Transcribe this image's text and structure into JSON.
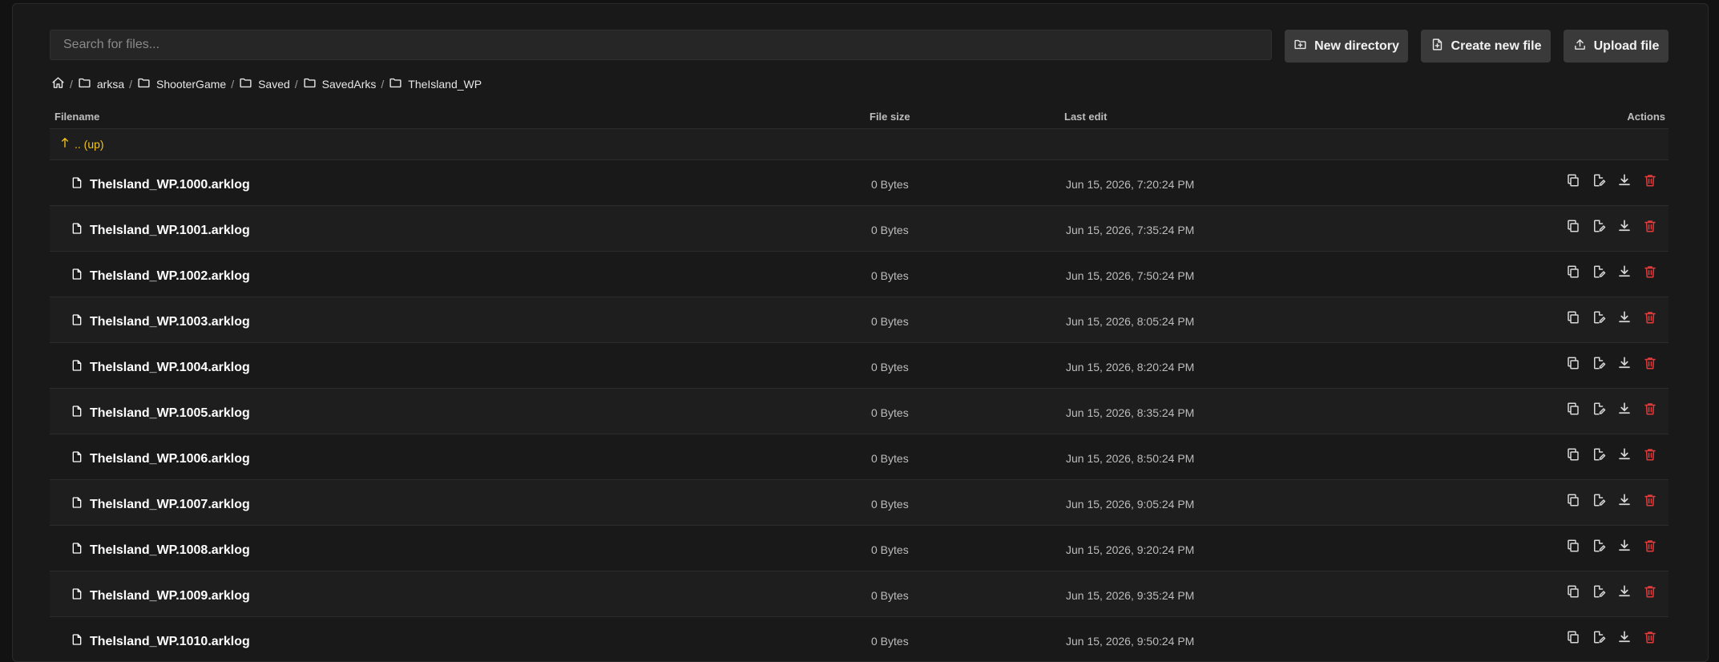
{
  "search": {
    "placeholder": "Search for files...",
    "value": ""
  },
  "toolbar": {
    "new_directory": "New directory",
    "create_new_file": "Create new file",
    "upload_file": "Upload file"
  },
  "breadcrumb": [
    "arksa",
    "ShooterGame",
    "Saved",
    "SavedArks",
    "TheIsland_WP"
  ],
  "columns": {
    "filename": "Filename",
    "file_size": "File size",
    "last_edit": "Last edit",
    "actions": "Actions"
  },
  "up_row": {
    "label": ".. (up)"
  },
  "files": [
    {
      "name": "TheIsland_WP.1000.arklog",
      "size": "0 Bytes",
      "last_edit": "Jun 15, 2026, 7:20:24 PM"
    },
    {
      "name": "TheIsland_WP.1001.arklog",
      "size": "0 Bytes",
      "last_edit": "Jun 15, 2026, 7:35:24 PM"
    },
    {
      "name": "TheIsland_WP.1002.arklog",
      "size": "0 Bytes",
      "last_edit": "Jun 15, 2026, 7:50:24 PM"
    },
    {
      "name": "TheIsland_WP.1003.arklog",
      "size": "0 Bytes",
      "last_edit": "Jun 15, 2026, 8:05:24 PM"
    },
    {
      "name": "TheIsland_WP.1004.arklog",
      "size": "0 Bytes",
      "last_edit": "Jun 15, 2026, 8:20:24 PM"
    },
    {
      "name": "TheIsland_WP.1005.arklog",
      "size": "0 Bytes",
      "last_edit": "Jun 15, 2026, 8:35:24 PM"
    },
    {
      "name": "TheIsland_WP.1006.arklog",
      "size": "0 Bytes",
      "last_edit": "Jun 15, 2026, 8:50:24 PM"
    },
    {
      "name": "TheIsland_WP.1007.arklog",
      "size": "0 Bytes",
      "last_edit": "Jun 15, 2026, 9:05:24 PM"
    },
    {
      "name": "TheIsland_WP.1008.arklog",
      "size": "0 Bytes",
      "last_edit": "Jun 15, 2026, 9:20:24 PM"
    },
    {
      "name": "TheIsland_WP.1009.arklog",
      "size": "0 Bytes",
      "last_edit": "Jun 15, 2026, 9:35:24 PM"
    },
    {
      "name": "TheIsland_WP.1010.arklog",
      "size": "0 Bytes",
      "last_edit": "Jun 15, 2026, 9:50:24 PM"
    }
  ],
  "colors": {
    "accent_up": "#f5c518",
    "delete": "#e03b3b",
    "button_bg": "#3a3a3a"
  },
  "icons": {
    "home": "home-icon",
    "folder": "folder-icon",
    "file": "file-icon",
    "copy": "copy-icon",
    "edit": "edit-icon",
    "download": "download-icon",
    "delete": "trash-icon",
    "new_dir": "folder-plus-icon",
    "new_file": "file-plus-icon",
    "upload": "upload-icon",
    "up": "arrow-up-icon"
  }
}
